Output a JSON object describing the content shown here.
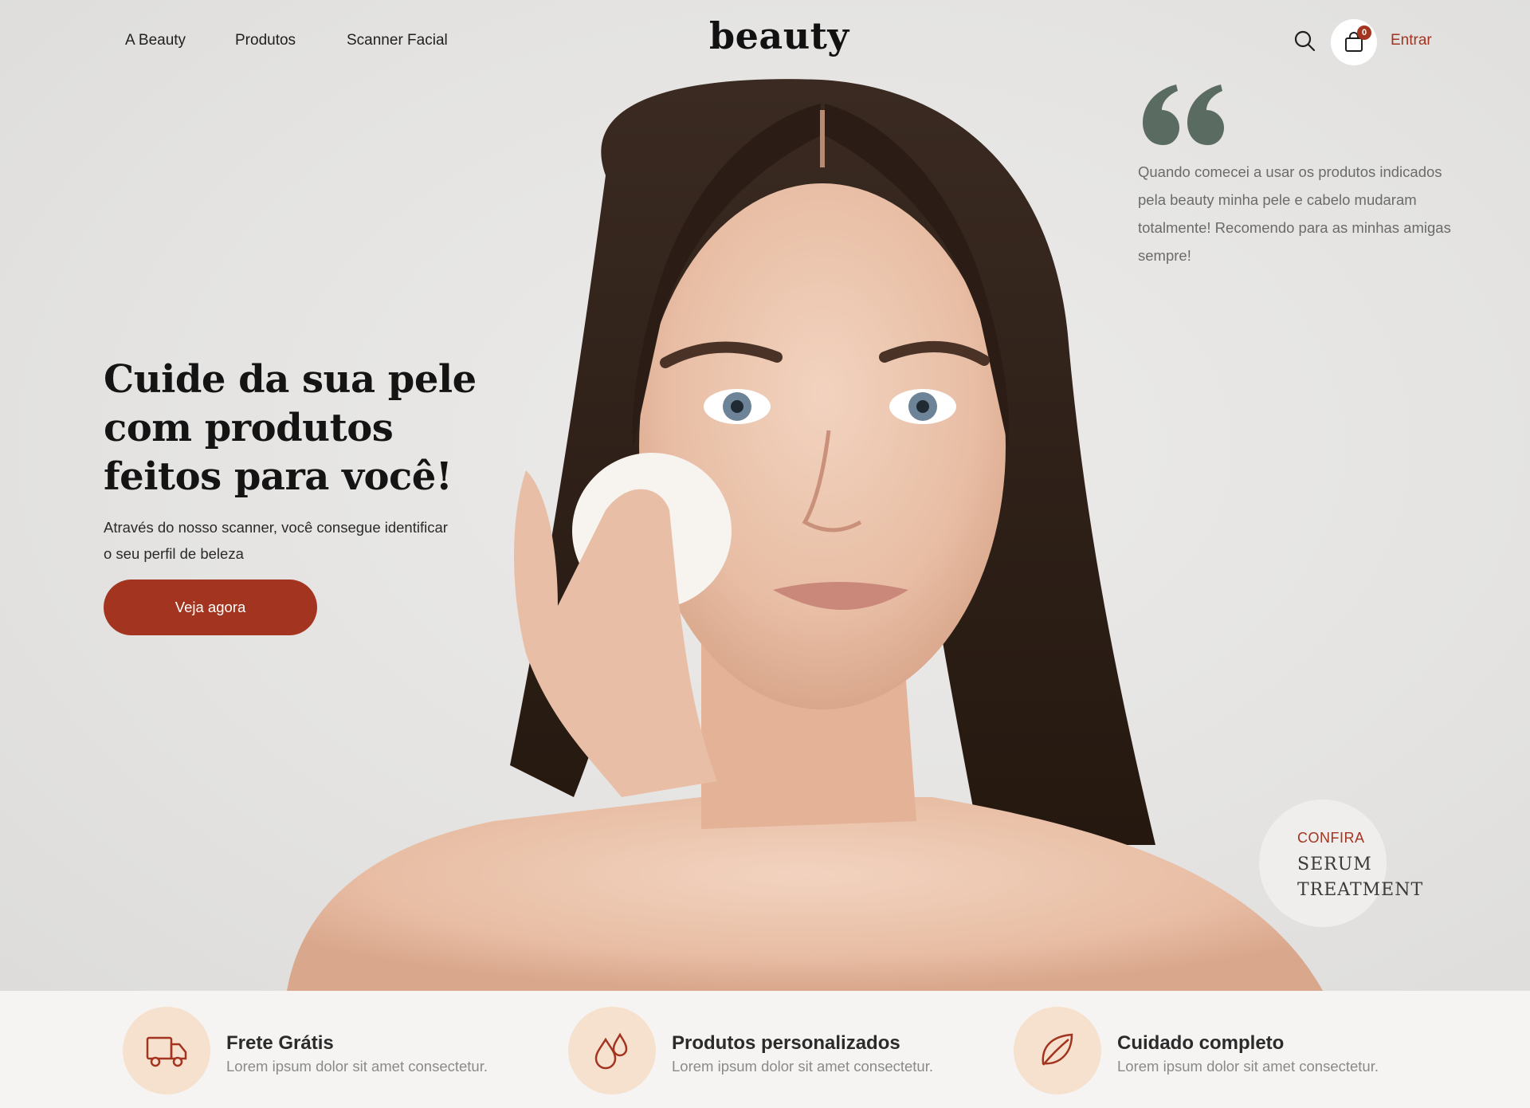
{
  "nav": {
    "links": [
      "A Beauty",
      "Produtos",
      "Scanner Facial"
    ],
    "logo": "beauty",
    "cart_count": "0",
    "login": "Entrar",
    "icons": {
      "search": "search-icon",
      "cart": "shopping-bag-icon"
    }
  },
  "quote": {
    "text": "Quando comecei a usar os produtos indicados pela beauty minha pele e cabelo mudaram totalmente! Recomendo para as minhas amigas sempre!"
  },
  "hero": {
    "headline": "Cuide da sua pele com produtos feitos para você!",
    "subtitle": "Através do nosso scanner, você consegue identificar o seu perfil de beleza",
    "cta": "Veja agora"
  },
  "serum": {
    "top": "CONFIRA",
    "main": "SERUM TREATMENT"
  },
  "features": [
    {
      "title": "Frete Grátis",
      "desc": "Lorem ipsum dolor sit amet consectetur.",
      "icon": "truck-icon"
    },
    {
      "title": "Produtos personalizados",
      "desc": "Lorem ipsum dolor sit amet consectetur.",
      "icon": "droplets-icon"
    },
    {
      "title": "Cuidado completo",
      "desc": "Lorem ipsum dolor sit amet consectetur.",
      "icon": "leaf-icon"
    }
  ],
  "colors": {
    "accent": "#a33520",
    "quote_mark": "#5a6b62",
    "feature_circle": "#f5e1ce",
    "background": "#e8e7e5"
  }
}
